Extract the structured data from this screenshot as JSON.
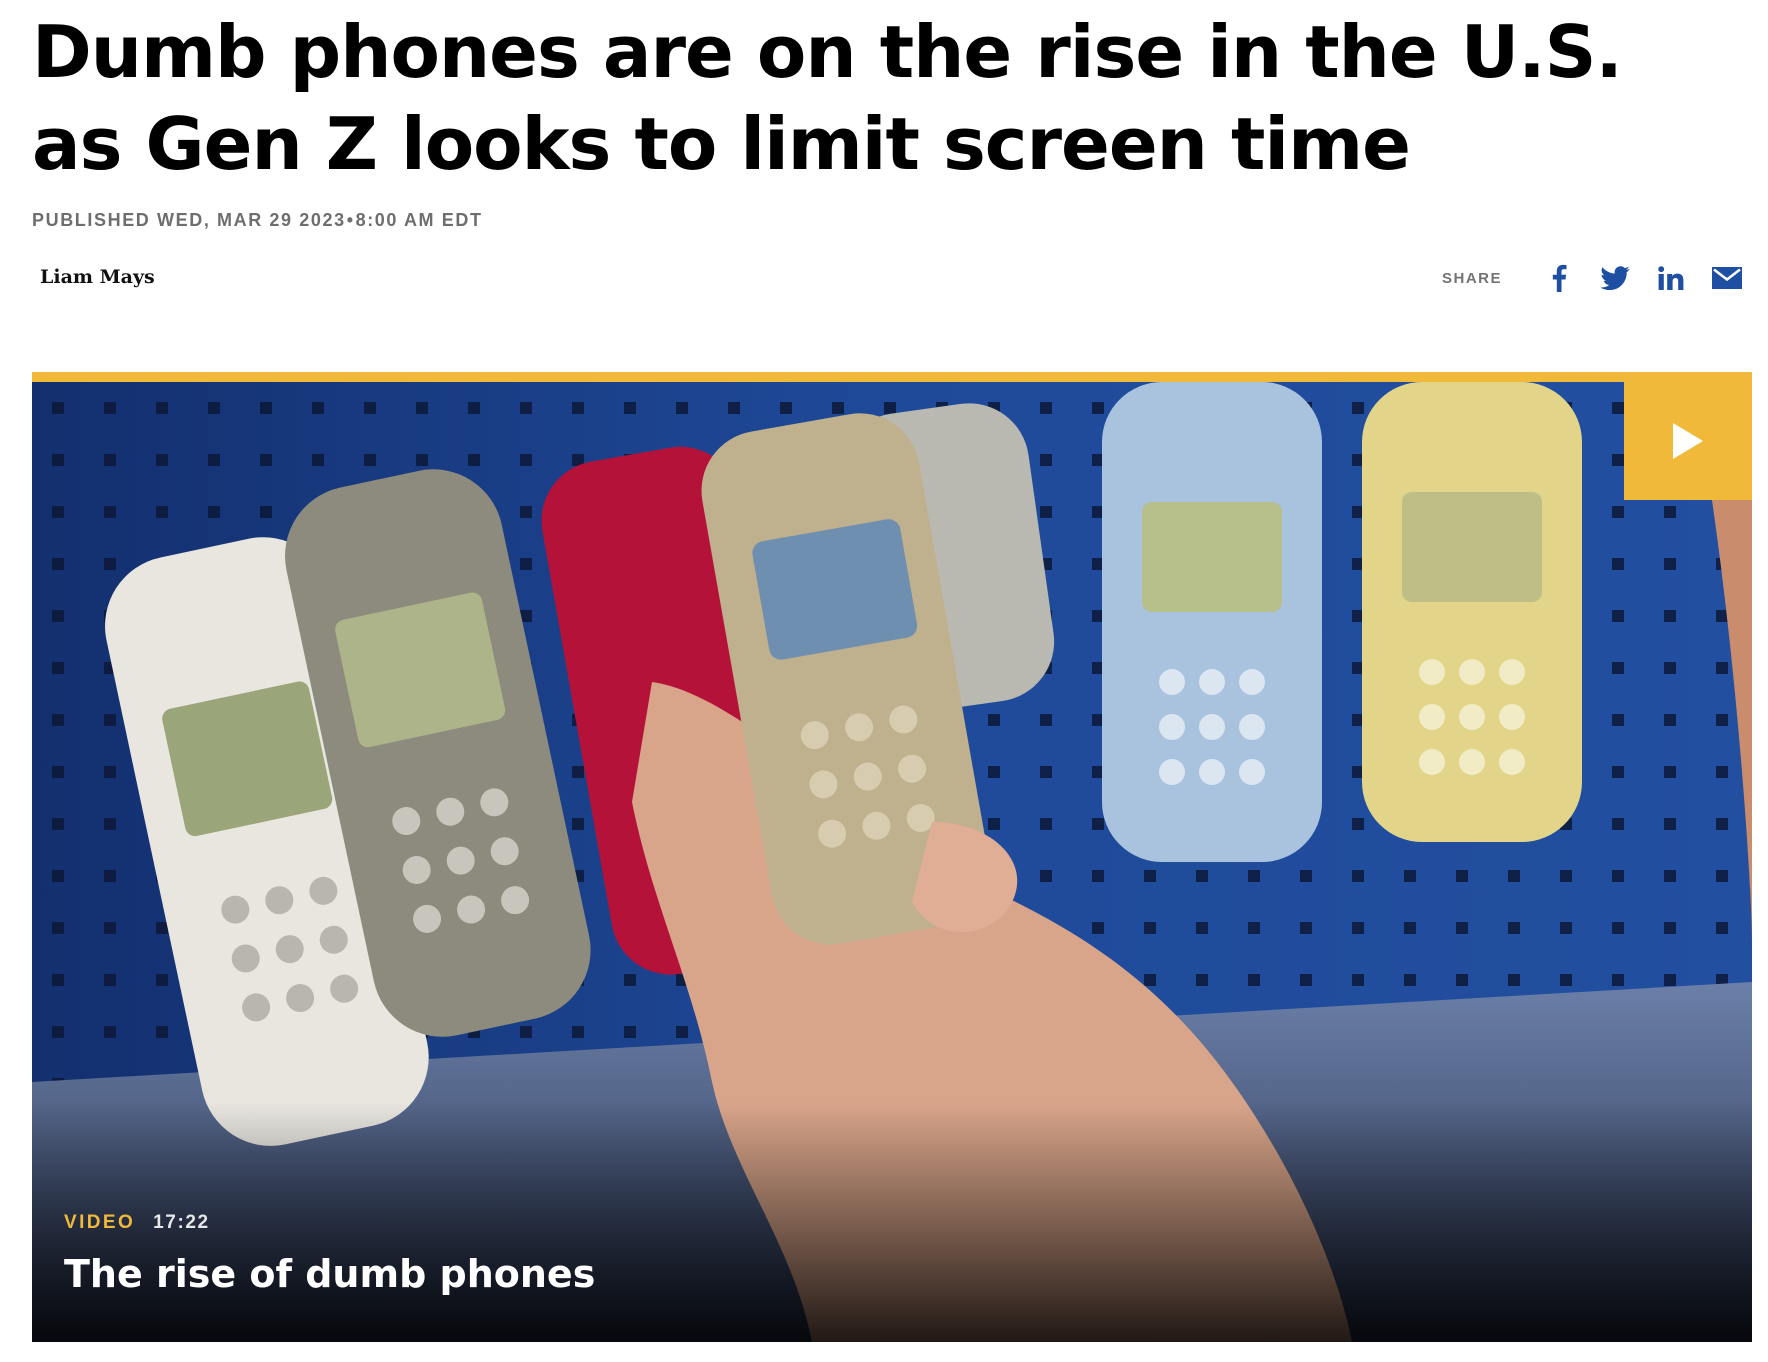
{
  "article": {
    "headline": "Dumb phones are on the rise in the U.S. as Gen Z looks to limit screen time",
    "published_label": "Published",
    "published_date": "Wed, Mar 29 2023",
    "published_separator": "•",
    "published_time": "8:00 AM EDT",
    "author": "Liam Mays"
  },
  "share": {
    "label": "SHARE",
    "buttons": [
      {
        "icon": "facebook-icon",
        "color": "#1f4fa3"
      },
      {
        "icon": "twitter-icon",
        "color": "#1f4fa3"
      },
      {
        "icon": "linkedin-icon",
        "color": "#1f4fa3"
      },
      {
        "icon": "email-icon",
        "color": "#1f4fa3"
      }
    ]
  },
  "video": {
    "tag": "VIDEO",
    "duration": "17:22",
    "title": "The rise of dumb phones",
    "accent_color": "#f0b93a",
    "play_icon": "play-icon"
  }
}
